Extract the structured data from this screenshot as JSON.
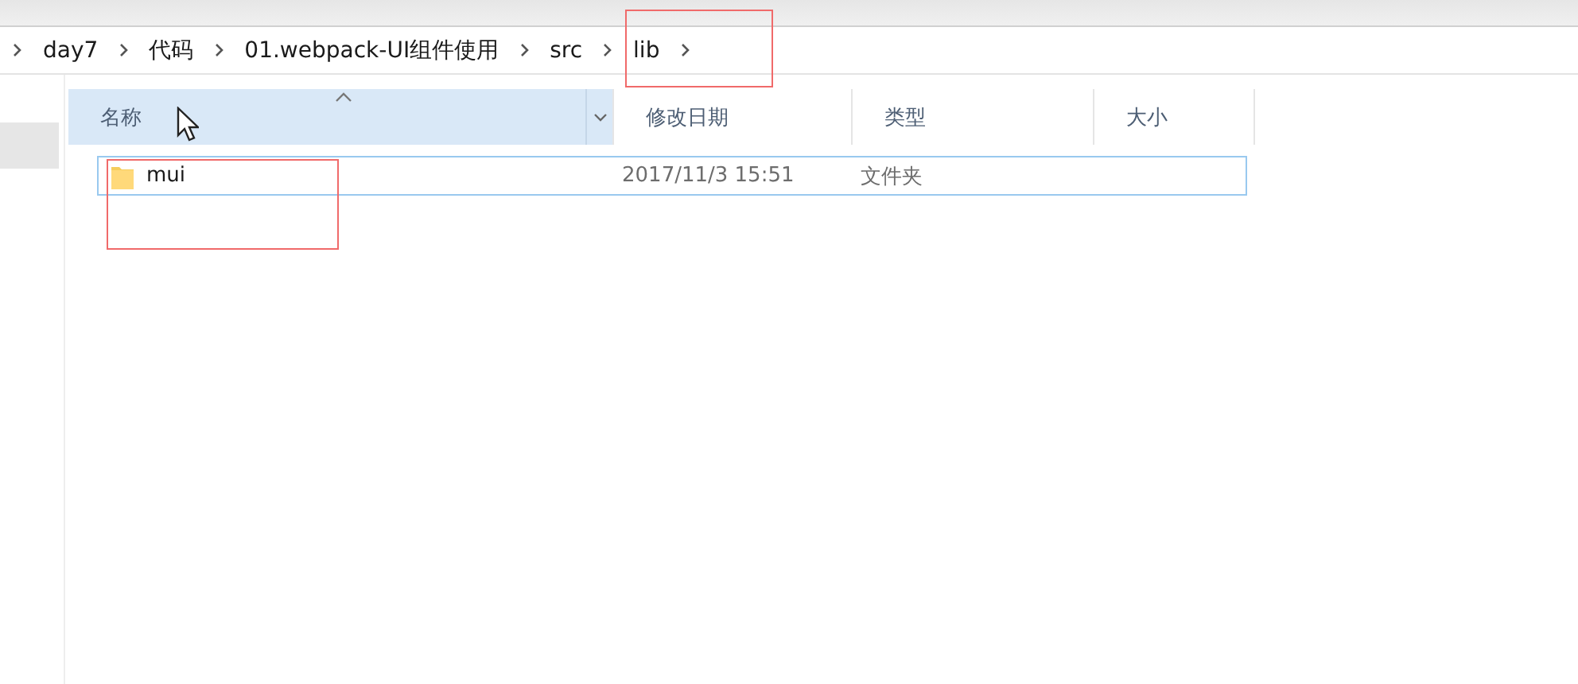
{
  "breadcrumb": [
    {
      "label": "day7"
    },
    {
      "label": "代码"
    },
    {
      "label": "01.webpack-UI组件使用"
    },
    {
      "label": "src"
    },
    {
      "label": "lib"
    }
  ],
  "columns": [
    {
      "label": "名称",
      "sorted": true,
      "hovered": true
    },
    {
      "label": "修改日期",
      "sorted": false,
      "hovered": false
    },
    {
      "label": "类型",
      "sorted": false,
      "hovered": false
    },
    {
      "label": "大小",
      "sorted": false,
      "hovered": false
    }
  ],
  "rows": [
    {
      "name": "mui",
      "date": "2017/11/3 15:51",
      "type": "文件夹",
      "focused": true
    }
  ]
}
